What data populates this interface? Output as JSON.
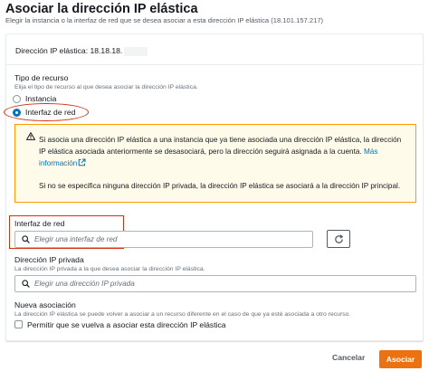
{
  "page": {
    "title": "Asociar la dirección IP elástica",
    "description": "Elegir la instancia o la interfaz de red que se desea asociar a esta dirección IP elástica (18.101.157.217)"
  },
  "eip": {
    "label": "Dirección IP elástica: 18.18.18."
  },
  "resource_type": {
    "label": "Tipo de recurso",
    "description": "Elija el tipo de recurso al que desea asociar la dirección IP elástica.",
    "options": [
      {
        "label": "Instancia",
        "selected": false
      },
      {
        "label": "Interfaz de red",
        "selected": true
      }
    ]
  },
  "alert": {
    "text1": "Si asocia una dirección IP elástica a una instancia que ya tiene asociada una dirección IP elástica, la dirección IP elástica asociada anteriormente se desasociará, pero la dirección seguirá asignada a la cuenta.",
    "link": "Más información",
    "text2": "Si no se especifica ninguna dirección IP privada, la dirección IP elástica se asociará a la dirección IP principal."
  },
  "network_interface": {
    "label": "Interfaz de red",
    "placeholder": "Elegir una interfaz de red"
  },
  "private_ip": {
    "label": "Dirección IP privada",
    "description": "La dirección IP privada a la que desea asociar la dirección IP elástica.",
    "placeholder": "Elegir una dirección IP privada"
  },
  "reassociation": {
    "label": "Nueva asociación",
    "description": "La dirección IP elástica se puede volver a asociar a un recurso diferente en el caso de que ya esté asociada a otro recurso.",
    "checkbox_label": "Permitir que se vuelva a asociar esta dirección IP elástica",
    "checked": false
  },
  "footer": {
    "cancel": "Cancelar",
    "submit": "Asociar"
  },
  "colors": {
    "primary": "#ec7211",
    "link": "#0073bb",
    "warning_bg": "#fffbeb",
    "warning_border": "#ff9900",
    "highlight": "#d13212"
  },
  "icons": [
    "warning-icon",
    "external-link-icon",
    "search-icon",
    "refresh-icon"
  ]
}
